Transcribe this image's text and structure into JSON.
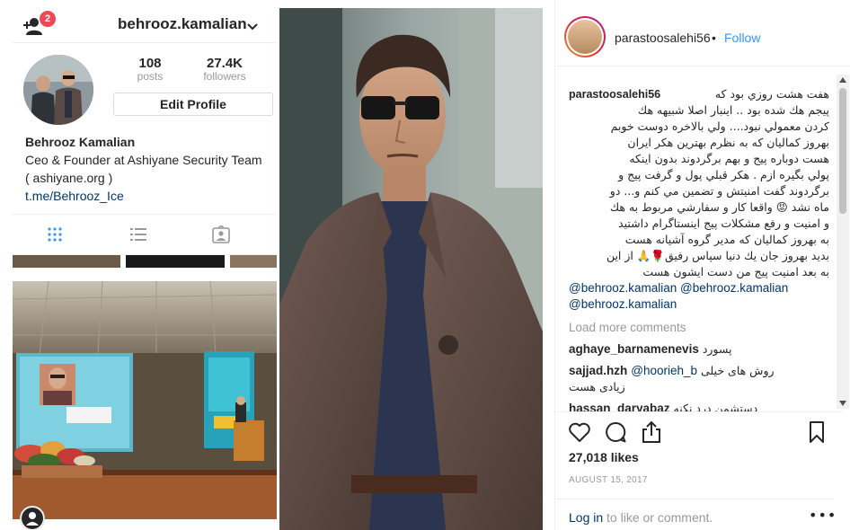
{
  "profile": {
    "username": "behrooz.kamalian",
    "notification_count": "2",
    "posts_count": "108",
    "posts_label": "posts",
    "followers_count": "27.4K",
    "followers_label": "followers",
    "edit_profile_label": "Edit Profile",
    "full_name": "Behrooz Kamalian",
    "bio_line1": "Ceo & Founder at Ashiyane Security Team",
    "bio_line2": "( ashiyane.org )",
    "bio_link": "t.me/Behrooz_Ice"
  },
  "post": {
    "author": "parastoosalehi56",
    "follow_label": "Follow",
    "caption_user": "parastoosalehi56",
    "caption_lines": [
      "هفت هشت روزي بود كه",
      "پيجم هك شده بود .. اينبار اصلا شبيهه هك",
      "كردن معمولي نبود.... ولي بالاخره دوست خوبم",
      "بهروز كماليان كه به نظرم بهترين هكر ايران",
      "هست دوباره پيج و بهم برگردوند بدون اينكه",
      "پولي بگيره ازم . هكر قبلي پول و گرفت پيج و",
      "برگردوند گفت امنيتش و تضمين مي كنم و... دو",
      "ماه نشد 😡 واقعا كار و سفارشي مربوط به هك",
      "و امنيت و رفع مشكلات پيج اينستاگرام داشتيد",
      "به بهروز كماليان كه مدير گروه آشيانه هست",
      "بديد بهروز جان يك دنيا سپاس رفيق🌹🙏 از اين",
      "به بعد امنيت پيج من دست ايشون هست"
    ],
    "mentions": [
      "@behrooz.kamalian @behrooz.kamalian",
      "@behrooz.kamalian"
    ],
    "load_more_label": "Load more comments",
    "comments": [
      {
        "user": "aghaye_barnamenevis",
        "text": "پسورد"
      },
      {
        "user": "sajjad.hzh",
        "mention": "@hoorieh_b",
        "text": "روش های خیلی",
        "text2": "زیادی هست"
      },
      {
        "user": "hassan_daryabaz",
        "text": "دستشمن درد نکنه"
      }
    ],
    "likes": "27,018 likes",
    "date": "AUGUST 15, 2017",
    "login_link": "Log in",
    "login_rest": " to like or comment.",
    "more_label": "•••"
  },
  "icons": [
    "add-person-icon",
    "chevron-down-icon",
    "grid-icon",
    "list-icon",
    "tagged-icon",
    "heart-icon",
    "comment-icon",
    "share-icon",
    "bookmark-icon",
    "more-icon"
  ]
}
